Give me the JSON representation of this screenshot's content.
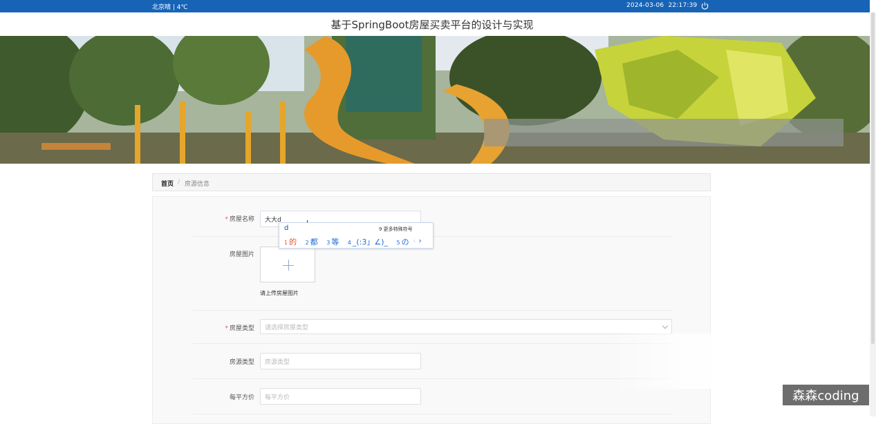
{
  "topbar": {
    "weather": "北京晴 | 4℃",
    "date": "2024-03-06",
    "time": "22:17:39",
    "power_icon": "power-icon"
  },
  "header": {
    "title": "基于SpringBoot房屋买卖平台的设计与实现"
  },
  "breadcrumb": {
    "home": "首页",
    "separator": "/",
    "current": "房源信息"
  },
  "form": {
    "house_name": {
      "label": "房屋名称",
      "required": "*",
      "value": "大大d"
    },
    "house_image": {
      "label": "房屋图片",
      "hint": "请上传房屋图片",
      "icon": "plus-icon"
    },
    "house_type": {
      "label": "房屋类型",
      "required": "*",
      "placeholder": "请选择房屋类型"
    },
    "source_type": {
      "label": "房源类型",
      "placeholder": "房源类型"
    },
    "price_per_sqm": {
      "label": "每平方价",
      "placeholder": "每平方价"
    }
  },
  "ime": {
    "typed": "d",
    "more": "9 更多特殊符号",
    "candidates": [
      {
        "n": "1",
        "text": "的"
      },
      {
        "n": "2",
        "text": "都"
      },
      {
        "n": "3",
        "text": "等"
      },
      {
        "n": "4",
        "text": "_(:3」∠)_"
      },
      {
        "n": "5",
        "text": "の"
      }
    ],
    "prev": "‹",
    "next": "›"
  },
  "watermark": {
    "text": "森森coding"
  },
  "colors": {
    "topbar": "#1764b7",
    "required": "#e55555",
    "ime_accent": "#1a6ad8"
  }
}
